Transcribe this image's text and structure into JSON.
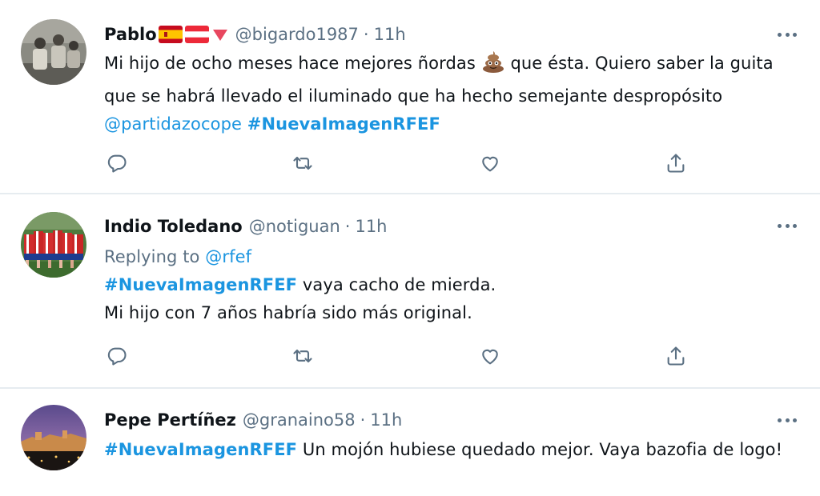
{
  "accent_color": "#1b95e0",
  "muted_color": "#5b7083",
  "tweets": [
    {
      "name": "Pablo",
      "name_decorations": [
        "spain-flag-emoji",
        "austria-flag-emoji",
        "red-triangle-emoji"
      ],
      "handle": "@bigardo1987",
      "sep": "·",
      "time": "11h",
      "text_a": "Mi hijo de ocho meses hace mejores ñordas ",
      "emoji": "pile-of-poo-emoji",
      "text_b": " que ésta. Quiero saber la guita que se habrá llevado el iluminado que ha hecho semejante despropósito ",
      "mention": "@partidazocope",
      "hashtag": "#NuevaImagenRFEF"
    },
    {
      "name": "Indio Toledano",
      "handle": "@notiguan",
      "sep": "·",
      "time": "11h",
      "replying_prefix": "Replying to ",
      "replying_to": "@rfef",
      "hashtag": "#NuevaImagenRFEF",
      "text_a": " vaya cacho de mierda.",
      "text_b": "Mi hijo con 7 años habría sido más original."
    },
    {
      "name": "Pepe Pertíñez",
      "handle": "@granaino58",
      "sep": "·",
      "time": "11h",
      "hashtag": "#NuevaImagenRFEF",
      "text_a": " Un mojón hubiese quedado mejor. Vaya bazofia de logo!"
    }
  ]
}
